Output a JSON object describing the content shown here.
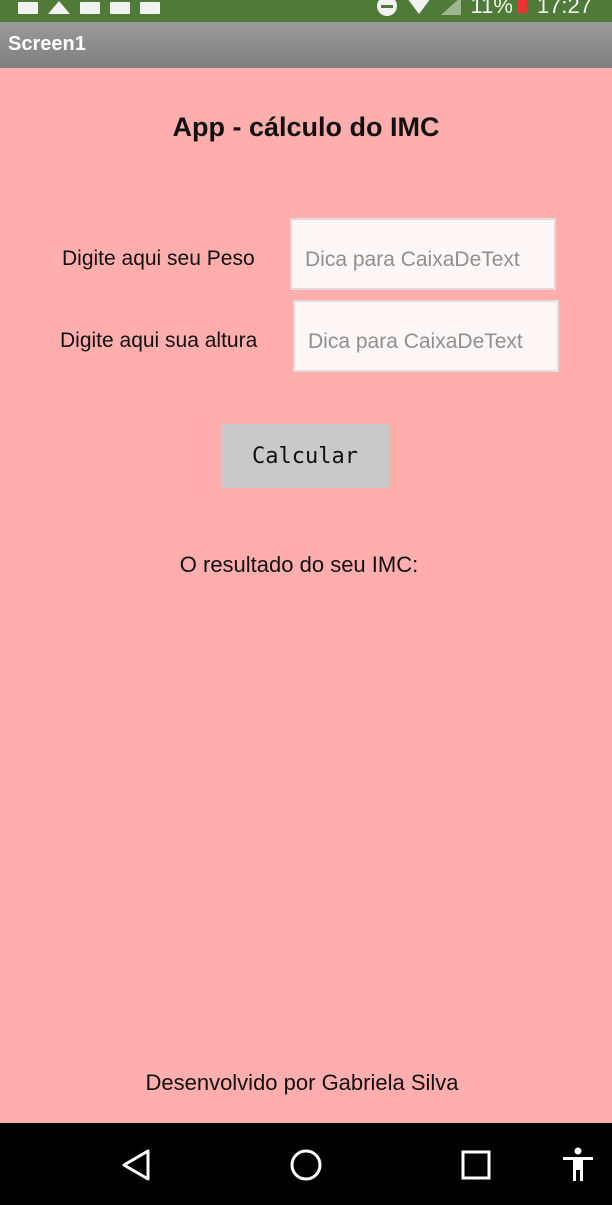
{
  "status_bar": {
    "battery_text": "11%",
    "time": "17:27"
  },
  "title_bar": {
    "title": "Screen1"
  },
  "main": {
    "app_title": "App - cálculo do IMC",
    "peso": {
      "label": "Digite aqui seu Peso",
      "placeholder": "Dica para CaixaDeText",
      "value": ""
    },
    "altura": {
      "label": "Digite aqui sua altura",
      "placeholder": "Dica para CaixaDeText",
      "value": ""
    },
    "calc_button_label": "Calcular",
    "result_label": "O resultado do seu IMC:",
    "footer_credit": "Desenvolvido por Gabriela Silva"
  },
  "colors": {
    "status_bar_bg": "#4f7a37",
    "title_bar_bg": "#8c8c8c",
    "content_bg": "#ffadad",
    "button_bg": "#c9c9c9",
    "nav_bar_bg": "#000000"
  },
  "navigation_bar": {
    "icons": [
      "back-icon",
      "home-icon",
      "recent-apps-icon",
      "accessibility-icon"
    ]
  }
}
